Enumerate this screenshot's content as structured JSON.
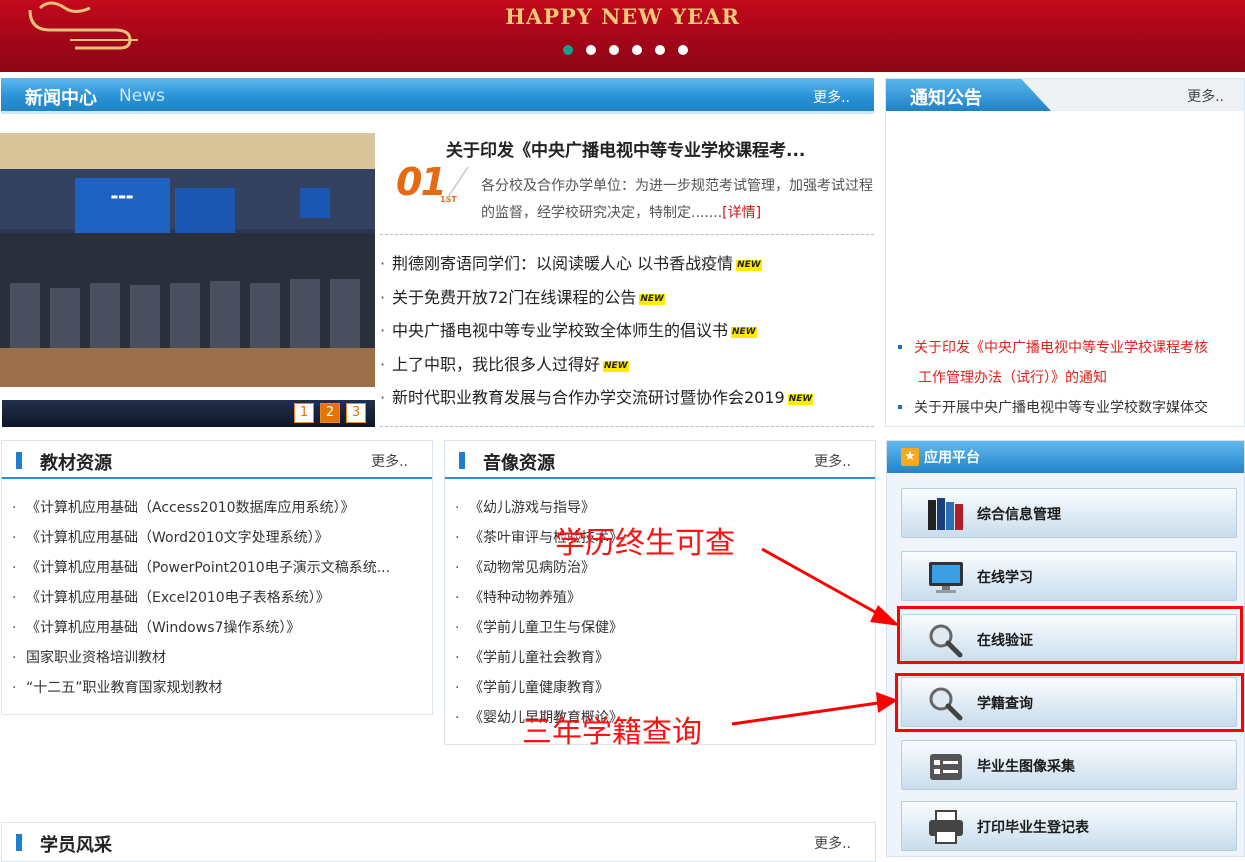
{
  "banner": {
    "title": "HAPPY NEW YEAR",
    "dots": 6
  },
  "news": {
    "title_cn": "新闻中心",
    "title_en": "News",
    "more": "更多..",
    "featured": {
      "num": "01",
      "num_sup": "1ST",
      "title": "关于印发《中央广播电视中等专业学校课程考...",
      "desc": "各分校及合作办学单位：为进一步规范考试管理，加强考试过程的监督，经学校研究决定，特制定.......",
      "detail": "[详情]"
    },
    "items": [
      "荆德刚寄语同学们：以阅读暖人心 以书香战疫情",
      "关于免费开放72门在线课程的公告",
      "中央广播电视中等专业学校致全体师生的倡议书",
      "上了中职，我比很多人过得好",
      "新时代职业教育发展与合作办学交流研讨暨协作会2019"
    ],
    "new_badge": "NEW",
    "pagers": [
      "1",
      "2",
      "3"
    ]
  },
  "notice": {
    "title": "通知公告",
    "more": "更多..",
    "items": [
      "关于印发《中央广播电视中等专业学校课程考核",
      "工作管理办法（试行）》的通知",
      "关于开展中央广播电视中等专业学校数字媒体交"
    ]
  },
  "textbooks": {
    "title": "教材资源",
    "more": "更多..",
    "items": [
      "《计算机应用基础（Access2010数据库应用系统）》",
      "《计算机应用基础（Word2010文字处理系统）》",
      "《计算机应用基础（PowerPoint2010电子演示文稿系统...",
      "《计算机应用基础（Excel2010电子表格系统）》",
      "《计算机应用基础（Windows7操作系统）》",
      "国家职业资格培训教材",
      "“十二五”职业教育国家规划教材"
    ]
  },
  "media": {
    "title": "音像资源",
    "more": "更多..",
    "items": [
      "《幼儿游戏与指导》",
      "《茶叶审评与检验技术》",
      "《动物常见病防治》",
      "《特种动物养殖》",
      "《学前儿童卫生与保健》",
      "《学前儿童社会教育》",
      "《学前儿童健康教育》",
      "《婴幼儿早期教育概论》"
    ]
  },
  "students": {
    "title": "学员风采",
    "more": "更多.."
  },
  "apps": {
    "title": "应用平台",
    "buttons": [
      {
        "label": "综合信息管理",
        "icon": "books-icon"
      },
      {
        "label": "在线学习",
        "icon": "monitor-icon"
      },
      {
        "label": "在线验证",
        "icon": "magnifier-icon"
      },
      {
        "label": "学籍查询",
        "icon": "magnifier-icon"
      },
      {
        "label": "毕业生图像采集",
        "icon": "id-card-icon"
      },
      {
        "label": "打印毕业生登记表",
        "icon": "printer-icon"
      }
    ]
  },
  "annotations": {
    "top": "学历终生可查",
    "bottom": "三年学籍查询"
  },
  "colors": {
    "brand_blue": "#2a8fd6",
    "banner_red": "#b0071b",
    "accent_orange": "#e67300",
    "annotation_red": "#ff0000"
  }
}
